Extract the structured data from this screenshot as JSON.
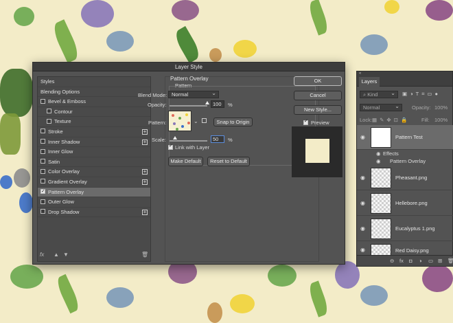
{
  "dialog": {
    "title": "Layer Style",
    "styles_header": "Styles",
    "blending_options": "Blending Options",
    "effects": [
      {
        "label": "Bevel & Emboss",
        "checked": false,
        "has_plus": false,
        "indent": false
      },
      {
        "label": "Contour",
        "checked": false,
        "has_plus": false,
        "indent": true
      },
      {
        "label": "Texture",
        "checked": false,
        "has_plus": false,
        "indent": true
      },
      {
        "label": "Stroke",
        "checked": false,
        "has_plus": true,
        "indent": false
      },
      {
        "label": "Inner Shadow",
        "checked": false,
        "has_plus": true,
        "indent": false
      },
      {
        "label": "Inner Glow",
        "checked": false,
        "has_plus": false,
        "indent": false
      },
      {
        "label": "Satin",
        "checked": false,
        "has_plus": false,
        "indent": false
      },
      {
        "label": "Color Overlay",
        "checked": false,
        "has_plus": true,
        "indent": false
      },
      {
        "label": "Gradient Overlay",
        "checked": false,
        "has_plus": true,
        "indent": false
      },
      {
        "label": "Pattern Overlay",
        "checked": true,
        "has_plus": false,
        "indent": false,
        "selected": true
      },
      {
        "label": "Outer Glow",
        "checked": false,
        "has_plus": false,
        "indent": false
      },
      {
        "label": "Drop Shadow",
        "checked": false,
        "has_plus": true,
        "indent": false
      }
    ],
    "footer_icons": {
      "fx": "fx",
      "up": "▲",
      "down": "▼",
      "trash": "🗑"
    },
    "pattern_overlay": {
      "title": "Pattern Overlay",
      "subtitle": "Pattern",
      "blend_mode_label": "Blend Mode:",
      "blend_mode_value": "Normal",
      "opacity_label": "Opacity:",
      "opacity_value": "100",
      "opacity_unit": "%",
      "opacity_fraction": 1.0,
      "pattern_label": "Pattern:",
      "snap_button": "Snap to Origin",
      "scale_label": "Scale:",
      "scale_value": "50",
      "scale_unit": "%",
      "link_label": "Link with Layer",
      "link_checked": true,
      "make_default": "Make Default",
      "reset_default": "Reset to Default"
    },
    "buttons": {
      "ok": "OK",
      "cancel": "Cancel",
      "new_style": "New Style..."
    },
    "preview_label": "Preview",
    "preview_checked": true
  },
  "layers_panel": {
    "tab": "Layers",
    "kind_label": "Kind",
    "blend_mode": "Normal",
    "opacity_label": "Opacity:",
    "opacity_value": "100%",
    "lock_label": "Lock:",
    "fill_label": "Fill:",
    "fill_value": "100%",
    "layers": [
      {
        "name": "Pattern Test",
        "selected": true,
        "thumb": "white"
      },
      {
        "name": "Pheasant.png",
        "selected": false,
        "thumb": "checker"
      },
      {
        "name": "Hellebore.png",
        "selected": false,
        "thumb": "checker"
      },
      {
        "name": "Eucalyptus 1.png",
        "selected": false,
        "thumb": "checker"
      },
      {
        "name": "Red Daisy.png",
        "selected": false,
        "thumb": "checker"
      }
    ],
    "effects_label": "Effects",
    "effect_item": "Pattern Overlay",
    "footer_icons": [
      "link-icon",
      "fx-icon",
      "mask-icon",
      "adjustment-icon",
      "folder-icon",
      "new-layer-icon",
      "trash-icon"
    ],
    "footer_glyphs": [
      "⊖",
      "fx",
      "◘",
      "◑",
      "▭",
      "⊞",
      "🗑"
    ]
  }
}
